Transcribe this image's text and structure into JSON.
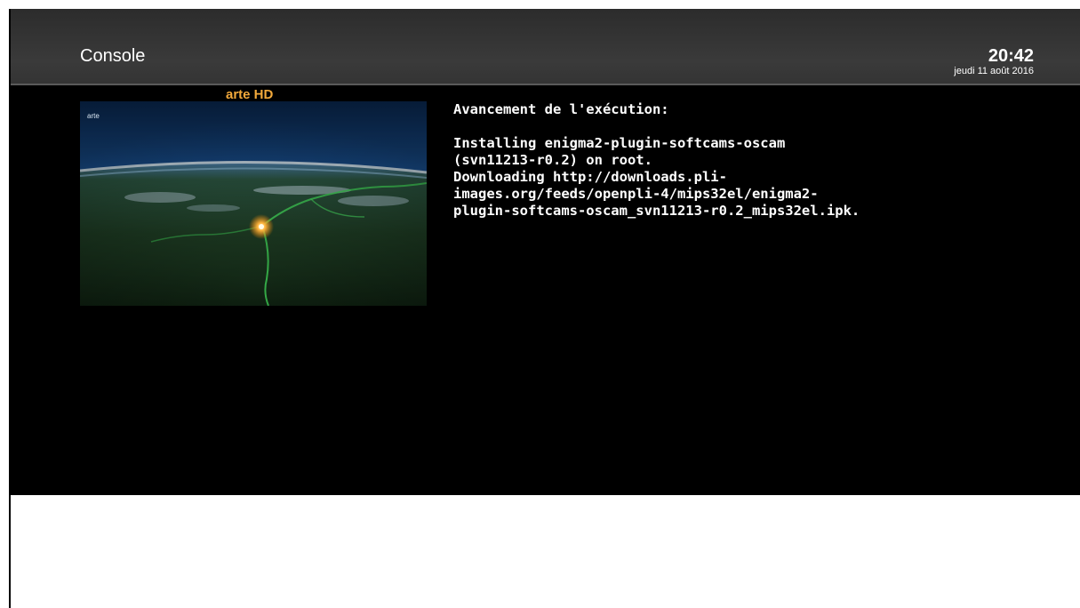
{
  "header": {
    "title": "Console",
    "time": "20:42",
    "date": "jeudi 11 août 2016"
  },
  "preview": {
    "channel_name": "arte HD",
    "channel_logo": "arte",
    "colors": {
      "channel_name": "#f2a93b"
    }
  },
  "console": {
    "heading": "Avancement de l'exécution:",
    "lines": [
      "Installing enigma2-plugin-softcams-oscam",
      "(svn11213-r0.2) on root.",
      "Downloading http://downloads.pli-",
      "images.org/feeds/openpli-4/mips32el/enigma2-",
      "plugin-softcams-oscam_svn11213-r0.2_mips32el.ipk."
    ]
  }
}
